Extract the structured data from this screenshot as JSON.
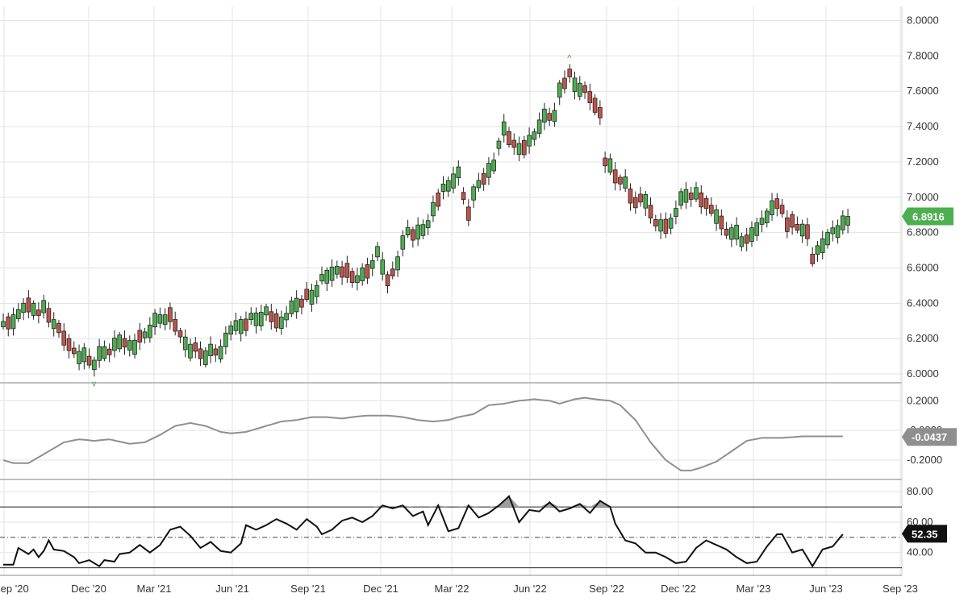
{
  "chart_data": {
    "type": "candlestick",
    "x_ticks": [
      "Sep '20",
      "Dec '20",
      "Mar '21",
      "Jun '21",
      "Sep '21",
      "Dec '21",
      "Mar '22",
      "Jun '22",
      "Sep '22",
      "Dec '22",
      "Mar '23",
      "Jun '23",
      "Sep '23"
    ],
    "panels": {
      "price": {
        "y_ticks": [
          "8.0000",
          "7.8000",
          "7.6000",
          "7.4000",
          "7.2000",
          "7.0000",
          "6.8000",
          "6.6000",
          "6.4000",
          "6.2000",
          "6.0000"
        ],
        "ylim": [
          5.95,
          8.08
        ],
        "last_value": "6.8916",
        "up_color": "#4caf50",
        "down_color": "#c0544a",
        "high_marker_glyph": "^",
        "low_marker_glyph": "v",
        "anchors": [
          [
            0,
            6.27
          ],
          [
            2,
            6.3
          ],
          [
            4,
            6.38
          ],
          [
            8,
            6.36
          ],
          [
            10,
            6.3
          ],
          [
            12,
            6.2
          ],
          [
            15,
            6.1
          ],
          [
            18,
            6.07
          ],
          [
            20,
            6.12
          ],
          [
            23,
            6.18
          ],
          [
            26,
            6.16
          ],
          [
            29,
            6.26
          ],
          [
            31,
            6.31
          ],
          [
            33,
            6.33
          ],
          [
            35,
            6.22
          ],
          [
            37,
            6.14
          ],
          [
            40,
            6.11
          ],
          [
            43,
            6.13
          ],
          [
            45,
            6.25
          ],
          [
            48,
            6.29
          ],
          [
            52,
            6.34
          ],
          [
            55,
            6.29
          ],
          [
            58,
            6.4
          ],
          [
            61,
            6.44
          ],
          [
            63,
            6.53
          ],
          [
            66,
            6.59
          ],
          [
            69,
            6.56
          ],
          [
            71,
            6.54
          ],
          [
            74,
            6.68
          ],
          [
            76,
            6.53
          ],
          [
            78,
            6.63
          ],
          [
            80,
            6.82
          ],
          [
            82,
            6.78
          ],
          [
            84,
            6.86
          ],
          [
            87,
            7.05
          ],
          [
            90,
            7.12
          ],
          [
            92,
            6.92
          ],
          [
            94,
            7.08
          ],
          [
            97,
            7.18
          ],
          [
            99,
            7.4
          ],
          [
            101,
            7.28
          ],
          [
            104,
            7.3
          ],
          [
            107,
            7.46
          ],
          [
            109,
            7.45
          ],
          [
            110,
            7.62
          ],
          [
            112,
            7.68
          ],
          [
            114,
            7.62
          ],
          [
            116,
            7.57
          ],
          [
            118,
            7.48
          ],
          [
            119,
            7.2
          ],
          [
            122,
            7.1
          ],
          [
            125,
            6.98
          ],
          [
            127,
            6.98
          ],
          [
            129,
            6.86
          ],
          [
            131,
            6.82
          ],
          [
            133,
            6.92
          ],
          [
            135,
            7.02
          ],
          [
            137,
            7.01
          ],
          [
            140,
            6.94
          ],
          [
            142,
            6.84
          ],
          [
            144,
            6.8
          ],
          [
            146,
            6.76
          ],
          [
            148,
            6.78
          ],
          [
            150,
            6.86
          ],
          [
            152,
            6.94
          ],
          [
            154,
            6.95
          ],
          [
            155,
            6.85
          ],
          [
            157,
            6.84
          ],
          [
            159,
            6.8
          ],
          [
            160,
            6.65
          ],
          [
            162,
            6.74
          ],
          [
            164,
            6.79
          ],
          [
            166,
            6.86
          ],
          [
            167,
            6.89
          ]
        ],
        "down_weeks": [
          1,
          5,
          7,
          9,
          11,
          12,
          13,
          14,
          17,
          21,
          24,
          27,
          33,
          34,
          35,
          38,
          39,
          42,
          48,
          53,
          54,
          59,
          60,
          67,
          68,
          69,
          72,
          76,
          77,
          81,
          86,
          91,
          92,
          95,
          100,
          101,
          103,
          108,
          111,
          112,
          115,
          116,
          117,
          118,
          119,
          121,
          122,
          124,
          125,
          126,
          128,
          129,
          131,
          136,
          138,
          139,
          140,
          142,
          143,
          147,
          153,
          154,
          155,
          156,
          157,
          159,
          160
        ]
      },
      "oscillator": {
        "y_ticks": [
          "0.2000",
          "-0.0000",
          "-0.2000"
        ],
        "ylim": [
          -0.33,
          0.31
        ],
        "last_value": "-0.0437",
        "line_color": "#8f8f8f",
        "points": [
          [
            0,
            -0.2
          ],
          [
            2,
            -0.22
          ],
          [
            5,
            -0.22
          ],
          [
            8,
            -0.16
          ],
          [
            12,
            -0.08
          ],
          [
            15,
            -0.06
          ],
          [
            18,
            -0.07
          ],
          [
            21,
            -0.06
          ],
          [
            25,
            -0.09
          ],
          [
            28,
            -0.08
          ],
          [
            31,
            -0.03
          ],
          [
            34,
            0.03
          ],
          [
            37,
            0.05
          ],
          [
            40,
            0.03
          ],
          [
            43,
            -0.01
          ],
          [
            45,
            -0.02
          ],
          [
            48,
            -0.01
          ],
          [
            52,
            0.03
          ],
          [
            55,
            0.06
          ],
          [
            58,
            0.07
          ],
          [
            61,
            0.09
          ],
          [
            64,
            0.09
          ],
          [
            67,
            0.08
          ],
          [
            69,
            0.09
          ],
          [
            72,
            0.1
          ],
          [
            76,
            0.1
          ],
          [
            79,
            0.09
          ],
          [
            82,
            0.07
          ],
          [
            85,
            0.06
          ],
          [
            88,
            0.07
          ],
          [
            90,
            0.09
          ],
          [
            93,
            0.11
          ],
          [
            96,
            0.17
          ],
          [
            99,
            0.18
          ],
          [
            102,
            0.2
          ],
          [
            105,
            0.21
          ],
          [
            108,
            0.2
          ],
          [
            110,
            0.18
          ],
          [
            113,
            0.21
          ],
          [
            115,
            0.22
          ],
          [
            117,
            0.21
          ],
          [
            120,
            0.2
          ],
          [
            122,
            0.17
          ],
          [
            125,
            0.07
          ],
          [
            128,
            -0.08
          ],
          [
            131,
            -0.2
          ],
          [
            134,
            -0.27
          ],
          [
            136,
            -0.27
          ],
          [
            138,
            -0.25
          ],
          [
            141,
            -0.21
          ],
          [
            144,
            -0.14
          ],
          [
            147,
            -0.07
          ],
          [
            150,
            -0.05
          ],
          [
            154,
            -0.05
          ],
          [
            158,
            -0.04
          ],
          [
            163,
            -0.04
          ],
          [
            166,
            -0.04
          ]
        ]
      },
      "rsi": {
        "y_ticks": [
          "80.00",
          "60.00",
          "40.00"
        ],
        "ylim": [
          25,
          87
        ],
        "overbought": 70,
        "oversold": 30,
        "midline": 50,
        "last_value": "52.35",
        "points": [
          [
            0,
            32
          ],
          [
            2,
            32
          ],
          [
            3,
            43
          ],
          [
            5,
            39
          ],
          [
            6,
            42
          ],
          [
            7,
            37
          ],
          [
            8,
            41
          ],
          [
            9,
            48
          ],
          [
            10,
            42
          ],
          [
            12,
            41
          ],
          [
            14,
            37
          ],
          [
            15,
            33
          ],
          [
            17,
            35
          ],
          [
            19,
            31
          ],
          [
            20,
            35
          ],
          [
            22,
            34
          ],
          [
            23,
            39
          ],
          [
            25,
            40
          ],
          [
            27,
            45
          ],
          [
            29,
            40
          ],
          [
            31,
            45
          ],
          [
            33,
            55
          ],
          [
            35,
            57
          ],
          [
            37,
            51
          ],
          [
            39,
            43
          ],
          [
            41,
            47
          ],
          [
            43,
            41
          ],
          [
            45,
            40
          ],
          [
            47,
            46
          ],
          [
            48,
            58
          ],
          [
            50,
            55
          ],
          [
            52,
            58
          ],
          [
            54,
            62
          ],
          [
            56,
            59
          ],
          [
            58,
            55
          ],
          [
            60,
            62
          ],
          [
            62,
            57
          ],
          [
            63,
            52
          ],
          [
            65,
            55
          ],
          [
            67,
            61
          ],
          [
            69,
            63
          ],
          [
            71,
            60
          ],
          [
            73,
            64
          ],
          [
            75,
            71
          ],
          [
            77,
            69
          ],
          [
            79,
            71
          ],
          [
            81,
            64
          ],
          [
            83,
            67
          ],
          [
            84,
            58
          ],
          [
            86,
            71
          ],
          [
            88,
            54
          ],
          [
            90,
            56
          ],
          [
            92,
            71
          ],
          [
            94,
            63
          ],
          [
            96,
            66
          ],
          [
            98,
            71
          ],
          [
            100,
            77
          ],
          [
            102,
            60
          ],
          [
            104,
            68
          ],
          [
            106,
            67
          ],
          [
            108,
            73
          ],
          [
            110,
            67
          ],
          [
            112,
            69
          ],
          [
            114,
            72
          ],
          [
            116,
            66
          ],
          [
            118,
            74
          ],
          [
            120,
            70
          ],
          [
            121,
            59
          ],
          [
            123,
            48
          ],
          [
            125,
            46
          ],
          [
            127,
            40
          ],
          [
            129,
            40
          ],
          [
            131,
            37
          ],
          [
            133,
            33
          ],
          [
            135,
            34
          ],
          [
            137,
            43
          ],
          [
            139,
            48
          ],
          [
            141,
            45
          ],
          [
            143,
            42
          ],
          [
            145,
            37
          ],
          [
            147,
            33
          ],
          [
            149,
            34
          ],
          [
            151,
            44
          ],
          [
            153,
            52
          ],
          [
            154,
            52
          ],
          [
            156,
            40
          ],
          [
            158,
            42
          ],
          [
            160,
            31
          ],
          [
            162,
            42
          ],
          [
            164,
            44
          ],
          [
            166,
            52
          ]
        ]
      }
    },
    "grid": true
  }
}
